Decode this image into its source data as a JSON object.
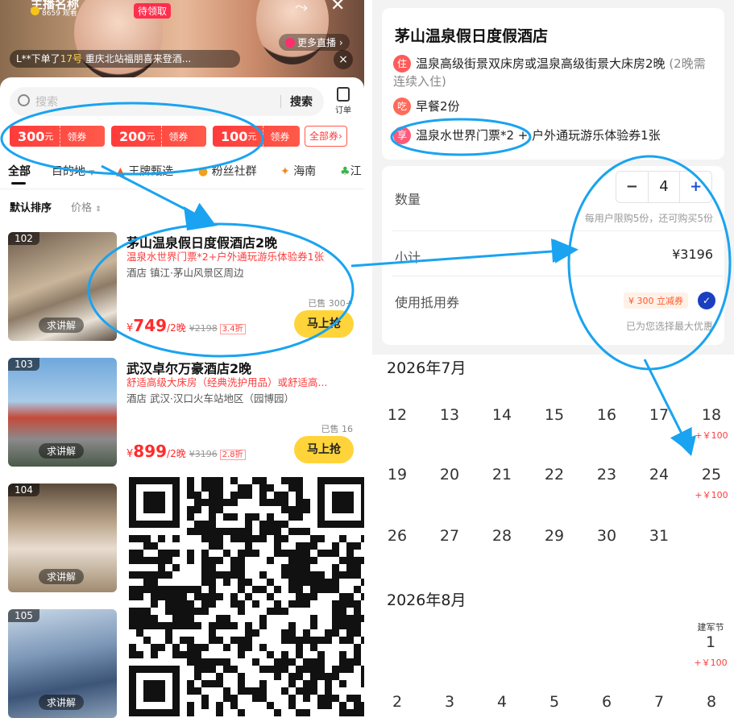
{
  "live": {
    "anchor_name": "主播名称",
    "viewers": "8659 观看",
    "pending_label": "待领取",
    "more_live": "更多直播",
    "ticker_prefix": "L**下单了",
    "ticker_highlight": "17号",
    "ticker_suffix": "重庆北站福朋喜来登酒...",
    "close": "×"
  },
  "search": {
    "placeholder": "搜索",
    "button": "搜索",
    "order_label": "订单"
  },
  "coupons": [
    {
      "amount": "300",
      "unit": "元",
      "action": "领券"
    },
    {
      "amount": "200",
      "unit": "元",
      "action": "领券"
    },
    {
      "amount": "100",
      "unit": "元",
      "action": "领券"
    }
  ],
  "all_coupons": "全部券",
  "tabs": [
    "全部",
    "目的地",
    "王牌甄选",
    "粉丝社群",
    "海南",
    "江"
  ],
  "sort": {
    "default": "默认排序",
    "price": "价格"
  },
  "hotels": [
    {
      "rank": "102",
      "title": "茅山温泉假日度假酒店2晚",
      "subtitle": "温泉水世界门票*2+户外通玩游乐体验券1张",
      "location": "酒店 镇江·茅山风景区周边",
      "sold": "已售 300+",
      "price_yen": "¥",
      "price": "749",
      "per": "/2晚",
      "orig": "¥2198",
      "discount": "3.4折",
      "explain": "求讲解",
      "grab": "马上抢"
    },
    {
      "rank": "103",
      "title": "武汉卓尔万豪酒店2晚",
      "subtitle": "舒适高级大床房（经典洗护用品）或舒适高...",
      "location": "酒店 武汉·汉口火车站地区（园博园）",
      "sold": "已售 16",
      "price_yen": "¥",
      "price": "899",
      "per": "/2晚",
      "orig": "¥3196",
      "discount": "2.8折",
      "explain": "求讲解",
      "grab": "马上抢"
    },
    {
      "rank": "104",
      "explain": "求讲解"
    },
    {
      "rank": "105",
      "explain": "求讲解"
    }
  ],
  "detail": {
    "title": "茅山温泉假日度假酒店",
    "perks": [
      {
        "badge": "住",
        "text": "温泉高级街景双床房或温泉高级街景大床房2晚",
        "note": "(2晚需连续入住)"
      },
      {
        "badge": "吃",
        "text": "早餐2份"
      },
      {
        "badge": "享",
        "text": "温泉水世界门票*2 + 户外通玩游乐体验券1张"
      }
    ],
    "quantity_label": "数量",
    "quantity": "4",
    "minus": "−",
    "plus": "+",
    "limit_text": "每用户限购5份，还可购买5份",
    "subtotal_label": "小计",
    "subtotal": "¥3196",
    "voucher_label": "使用抵用券",
    "voucher_tag": "¥ 300 立减券",
    "best_text": "已为您选择最大优惠"
  },
  "calendar": {
    "july": {
      "title": "2026年7月",
      "weeks": [
        [
          "12",
          "13",
          "14",
          "15",
          "16",
          "17",
          "18"
        ],
        [
          "19",
          "20",
          "21",
          "22",
          "23",
          "24",
          "25"
        ],
        [
          "26",
          "27",
          "28",
          "29",
          "30",
          "31",
          ""
        ]
      ],
      "surcharge": "+￥100"
    },
    "august": {
      "title": "2026年8月",
      "holiday": "建军节",
      "day1": "1",
      "surcharge": "+￥100",
      "week2": [
        "2",
        "3",
        "4",
        "5",
        "6",
        "7",
        "8"
      ]
    }
  },
  "colors": {
    "accent_red": "#ff3b3b",
    "grab_yellow": "#ffd43a",
    "annotation_blue": "#1aa3f0",
    "check_blue": "#1a3fbf"
  }
}
